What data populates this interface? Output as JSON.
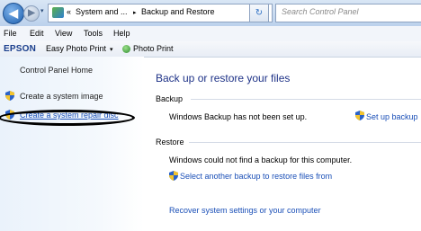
{
  "address_bar": {
    "crumb_overflow": "«",
    "crumb_1": "System and ...",
    "separator": "▸",
    "crumb_2": "Backup and Restore",
    "search_placeholder": "Search Control Panel"
  },
  "menu": [
    "File",
    "Edit",
    "View",
    "Tools",
    "Help"
  ],
  "toolbar": {
    "brand": "EPSON",
    "easy_photo_print": "Easy Photo Print",
    "photo_print": "Photo Print"
  },
  "left_pane": {
    "home": "Control Panel Home",
    "create_image": "Create a system image",
    "create_repair_disc": "Create a system repair disc"
  },
  "main": {
    "title": "Back up or restore your files",
    "backup_heading": "Backup",
    "backup_status": "Windows Backup has not been set up.",
    "setup_backup": "Set up backup",
    "restore_heading": "Restore",
    "restore_status": "Windows could not find a backup for this computer.",
    "select_backup": "Select another backup to restore files from",
    "recover": "Recover system settings or your computer"
  },
  "colors": {
    "link": "#1a4fb7",
    "title": "#1e3287",
    "annotation": "#000000"
  }
}
